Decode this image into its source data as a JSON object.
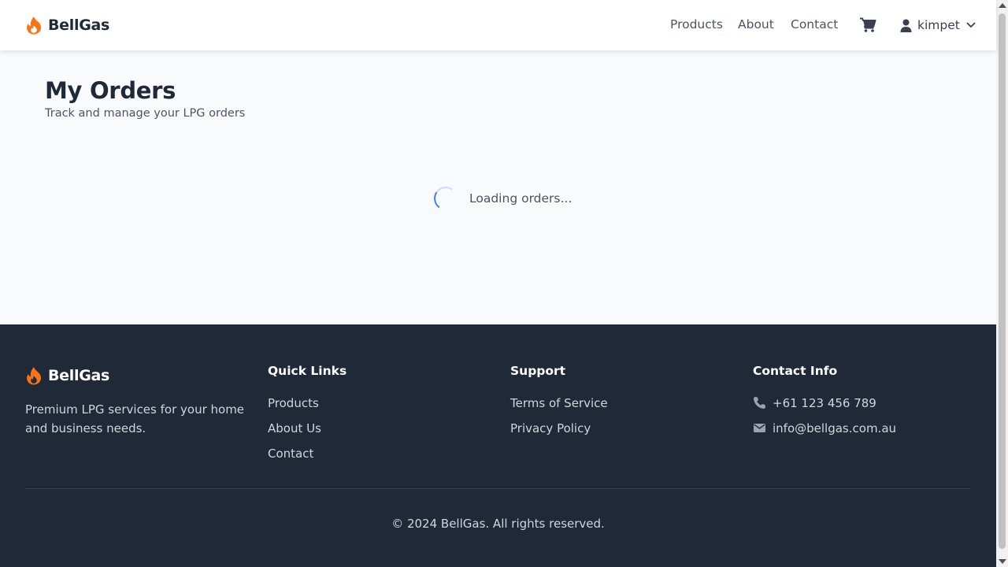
{
  "header": {
    "brand": "BellGas",
    "nav": [
      {
        "label": "Products"
      },
      {
        "label": "About"
      },
      {
        "label": "Contact"
      }
    ],
    "cart_icon": "shopping-cart-icon",
    "user": {
      "name": "kimpet",
      "icon": "user-icon",
      "dropdown_icon": "chevron-down-icon"
    }
  },
  "main": {
    "title": "My Orders",
    "subtitle": "Track and manage your LPG orders",
    "loading_text": "Loading orders..."
  },
  "footer": {
    "brand": "BellGas",
    "description": "Premium LPG services for your home and business needs.",
    "quick_links": {
      "heading": "Quick Links",
      "items": [
        {
          "label": "Products"
        },
        {
          "label": "About Us"
        },
        {
          "label": "Contact"
        }
      ]
    },
    "support": {
      "heading": "Support",
      "items": [
        {
          "label": "Terms of Service"
        },
        {
          "label": "Privacy Policy"
        }
      ]
    },
    "contact": {
      "heading": "Contact Info",
      "phone": "+61 123 456 789",
      "email": "info@bellgas.com.au"
    },
    "copyright": "© 2024 BellGas. All rights reserved."
  },
  "colors": {
    "brand_orange": "#f97316",
    "spinner_blue": "#3b82f6",
    "footer_bg": "#1f2937",
    "page_bg": "#f8fafc"
  }
}
